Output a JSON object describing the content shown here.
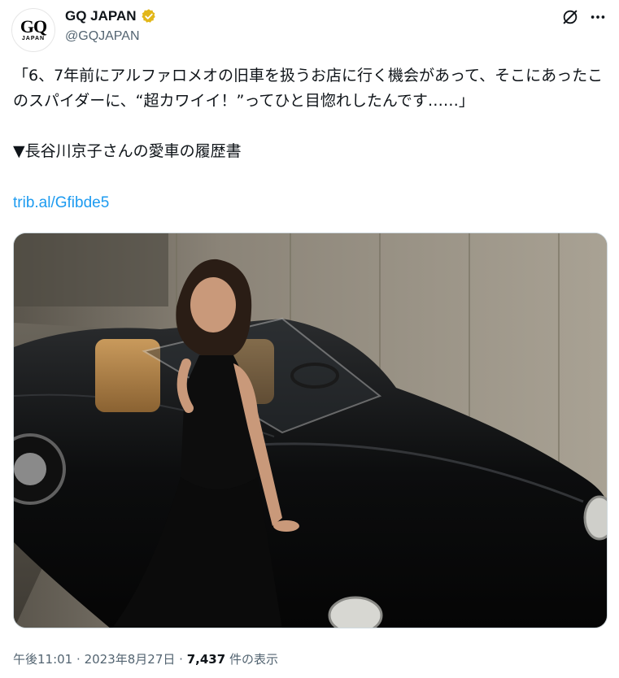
{
  "account": {
    "name": "GQ JAPAN",
    "handle": "@GQJAPAN",
    "logo_main": "GQ",
    "logo_sub": "JAPAN",
    "verified": true,
    "verified_color": "#e2b719"
  },
  "header_icons": [
    "grok-icon",
    "more-icon"
  ],
  "tweet": {
    "text": "「6、7年前にアルファロメオの旧車を扱うお店に行く機会があって、そこにあったこのスパイダーに、“超カワイイ！”ってひと目惚れしたんです……」\n\n▼長谷川京子さんの愛車の履歴書",
    "link": "trib.al/Gfibde5",
    "link_color": "#1d9bf0"
  },
  "meta": {
    "time": "午後11:01",
    "date": "2023年8月27日",
    "views_count": "7,437",
    "views_label": "件の表示",
    "separator": "·"
  }
}
